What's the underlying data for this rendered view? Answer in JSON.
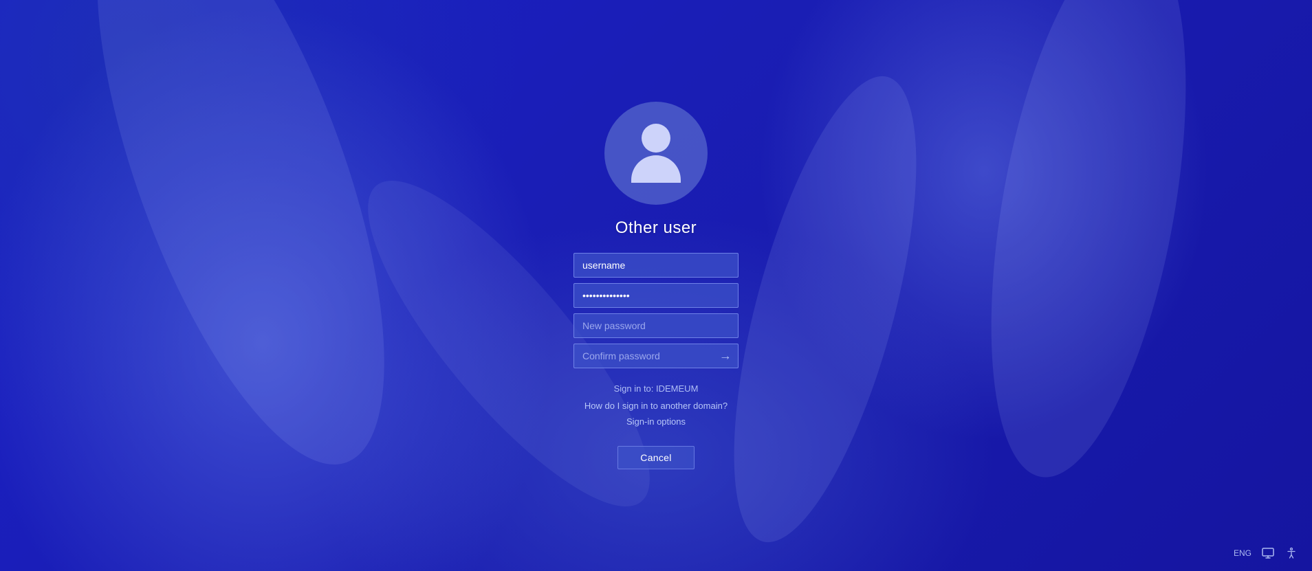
{
  "background": {
    "color": "#1a1eb5"
  },
  "login": {
    "title": "Other user",
    "avatar_alt": "User avatar",
    "username_placeholder": "username",
    "password_placeholder": "••••••••••••••",
    "new_password_placeholder": "New password",
    "confirm_password_placeholder": "Confirm password",
    "sign_in_label": "Sign in to: IDEMEUM",
    "how_to_sign_in_link": "How do I sign in to another domain?",
    "sign_in_options_link": "Sign-in options",
    "cancel_button_label": "Cancel"
  },
  "bottom_bar": {
    "language_label": "ENG",
    "monitor_icon": "monitor-icon",
    "accessibility_icon": "accessibility-icon"
  }
}
